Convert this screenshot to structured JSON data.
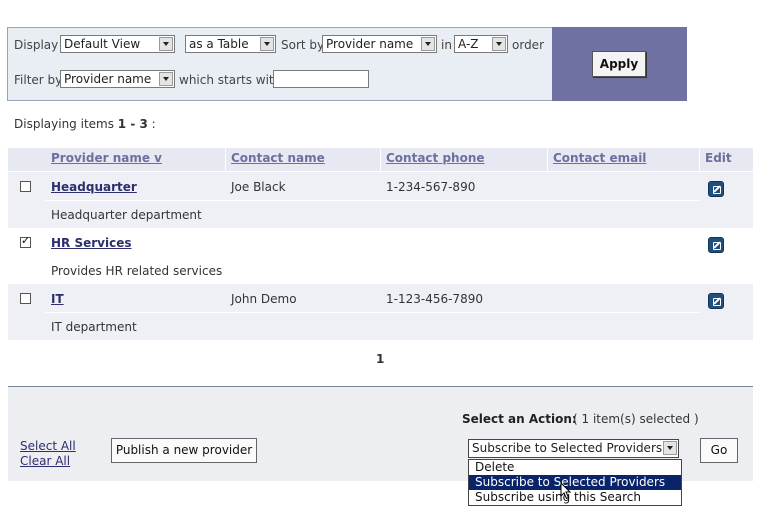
{
  "filter": {
    "display_label": "Display",
    "view_value": "Default View",
    "format_value": "as a Table",
    "sort_label": "Sort by",
    "sort_value": "Provider name",
    "in_label": "in",
    "order_value": "A-Z",
    "order_label": "order",
    "filter_label": "Filter by",
    "filter_field_value": "Provider name",
    "starts_with_label": "which starts with",
    "starts_with_value": "",
    "apply_label": "Apply"
  },
  "summary": {
    "prefix": "Displaying items",
    "range": "1 - 3",
    "suffix": ":"
  },
  "table": {
    "columns": [
      "Provider name v",
      "Contact name",
      "Contact phone",
      "Contact email",
      "Edit"
    ],
    "rows": [
      {
        "checked": false,
        "name": "Headquarter",
        "contact": "Joe Black",
        "phone": "1-234-567-890",
        "email": "",
        "description": "Headquarter department"
      },
      {
        "checked": true,
        "name": "HR Services",
        "contact": "",
        "phone": "",
        "email": "",
        "description": "Provides HR related services"
      },
      {
        "checked": false,
        "name": "IT",
        "contact": "John Demo",
        "phone": "1-123-456-7890",
        "email": "",
        "description": "IT department"
      }
    ]
  },
  "pagination": {
    "current_page": "1"
  },
  "actions": {
    "select_all": "Select All",
    "clear_all": "Clear All",
    "publish_label": "Publish a new provider",
    "select_action_label": "Select an Action:",
    "selected_count": "( 1 item(s) selected )",
    "action_value": "Subscribe to Selected Providers",
    "options": [
      "Delete",
      "Subscribe to Selected Providers",
      "Subscribe using this Search"
    ],
    "go_label": "Go"
  },
  "colors": {
    "accent_panel": "#6f71a3",
    "link": "#2c2e6e",
    "header_text": "#6d6f9f",
    "selection": "#0a246a"
  },
  "icons": [
    "chevron-down-icon",
    "checkbox-icon",
    "edit-icon",
    "mouse-cursor-icon"
  ]
}
